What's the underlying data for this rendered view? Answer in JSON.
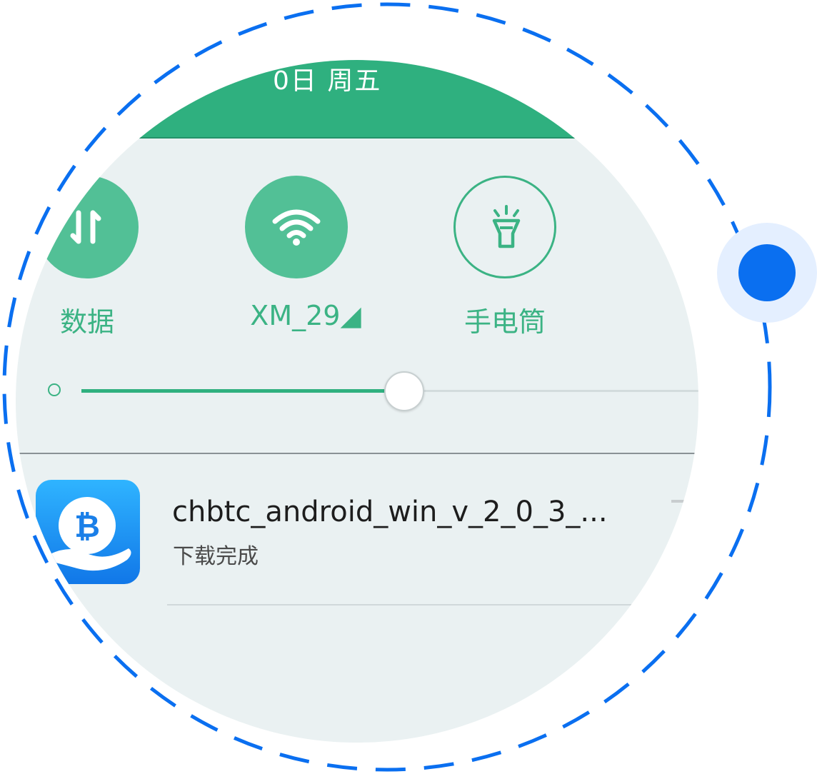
{
  "header": {
    "date_text": "0日 周五"
  },
  "quick_toggles": [
    {
      "label": "数据",
      "icon": "mobile-data-icon",
      "state": "on"
    },
    {
      "label": "XM_29◢",
      "icon": "wifi-icon",
      "state": "on"
    },
    {
      "label": "手电筒",
      "icon": "flashlight-icon",
      "state": "off"
    }
  ],
  "brightness": {
    "icon": "brightness-low-icon",
    "level_percent": 52
  },
  "notification": {
    "app_icon": "bitcoin-hand-app-icon",
    "title": "chbtc_android_win_v_2_0_3_...",
    "subtitle": "下载完成"
  },
  "colors": {
    "accent_green": "#2fb07f",
    "toggle_on_green": "#52c096",
    "indicator_blue": "#0a6ff0",
    "panel_background": "#eaf1f2"
  }
}
